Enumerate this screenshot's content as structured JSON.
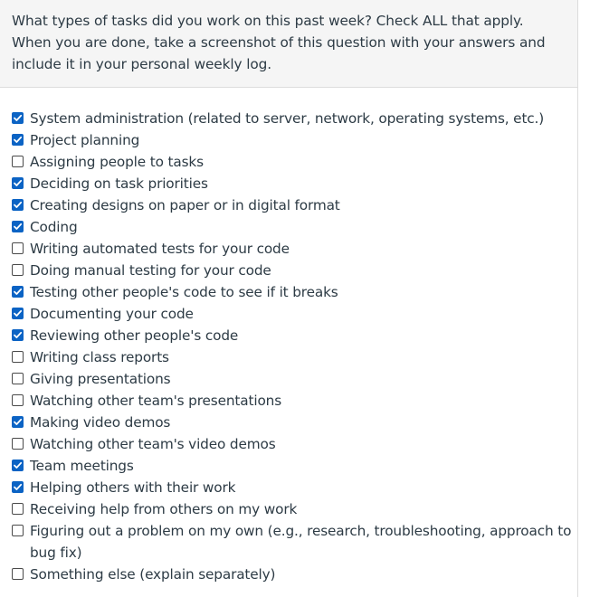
{
  "question": {
    "text": "What types of tasks did you work on this past week? Check ALL that apply. When you are done, take a screenshot of this question with your answers and include it in your personal weekly log."
  },
  "colors": {
    "checked_fill": "#0b63c4",
    "header_background": "#f5f5f5",
    "text": "#2d3b45"
  },
  "options": [
    {
      "label": "System administration (related to server, network, operating systems, etc.)",
      "checked": true
    },
    {
      "label": "Project planning",
      "checked": true
    },
    {
      "label": "Assigning people to tasks",
      "checked": false
    },
    {
      "label": "Deciding on task priorities",
      "checked": true
    },
    {
      "label": "Creating designs on paper or in digital format",
      "checked": true
    },
    {
      "label": "Coding",
      "checked": true
    },
    {
      "label": "Writing automated tests for your code",
      "checked": false
    },
    {
      "label": "Doing manual testing for your code",
      "checked": false
    },
    {
      "label": "Testing other people's code to see if it breaks",
      "checked": true
    },
    {
      "label": "Documenting your code",
      "checked": true
    },
    {
      "label": "Reviewing other people's code",
      "checked": true
    },
    {
      "label": "Writing class reports",
      "checked": false
    },
    {
      "label": "Giving presentations",
      "checked": false
    },
    {
      "label": "Watching other team's presentations",
      "checked": false
    },
    {
      "label": "Making video demos",
      "checked": true
    },
    {
      "label": "Watching other team's video demos",
      "checked": false
    },
    {
      "label": "Team meetings",
      "checked": true
    },
    {
      "label": "Helping others with their work",
      "checked": true
    },
    {
      "label": "Receiving help from others on my work",
      "checked": false
    },
    {
      "label": "Figuring out a problem on my own (e.g., research, troubleshooting, approach to bug fix)",
      "checked": false
    },
    {
      "label": "Something else (explain separately)",
      "checked": false
    }
  ]
}
